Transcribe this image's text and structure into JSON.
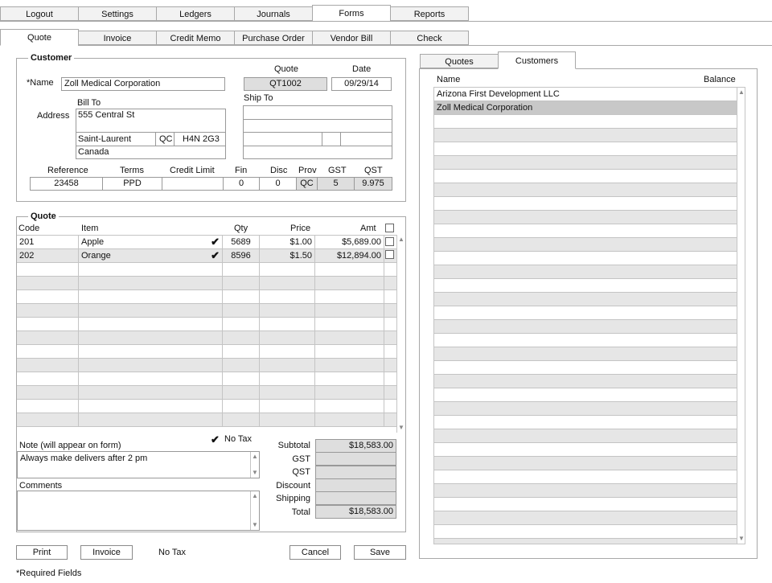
{
  "main_tabs": [
    "Logout",
    "Settings",
    "Ledgers",
    "Journals",
    "Forms",
    "Reports"
  ],
  "form_tabs": [
    "Quote",
    "Invoice",
    "Credit Memo",
    "Purchase Order",
    "Vendor Bill",
    "Check"
  ],
  "customer": {
    "legend": "Customer",
    "name_label": "*Name",
    "name": "Zoll Medical Corporation",
    "quote_label": "Quote",
    "quote_no": "QT1002",
    "date_label": "Date",
    "date": "09/29/14",
    "bill_to_label": "Bill To",
    "ship_to_label": "Ship To",
    "address_label": "Address",
    "address1": "555 Central St",
    "city": "Saint-Laurent",
    "prov": "QC",
    "postal": "H4N 2G3",
    "country": "Canada",
    "reference_label": "Reference",
    "terms_label": "Terms",
    "credit_limit_label": "Credit Limit",
    "fin_label": "Fin",
    "disc_label": "Disc",
    "prov_label": "Prov",
    "gst_label": "GST",
    "qst_label": "QST",
    "reference": "23458",
    "terms": "PPD",
    "credit_limit": "",
    "fin": "0",
    "disc": "0",
    "prov_value": "QC",
    "gst": "5",
    "qst": "9.975"
  },
  "quote": {
    "legend": "Quote",
    "headers": {
      "code": "Code",
      "item": "Item",
      "qty": "Qty",
      "price": "Price",
      "amt": "Amt"
    },
    "lines": [
      {
        "code": "201",
        "item": "Apple",
        "qty": "5689",
        "price": "$1.00",
        "amt": "$5,689.00"
      },
      {
        "code": "202",
        "item": "Orange",
        "qty": "8596",
        "price": "$1.50",
        "amt": "$12,894.00"
      }
    ],
    "check_glyph": "✔",
    "no_tax_label": "No Tax",
    "note_label": "Note (will appear on form)",
    "note": "Always make delivers after 2 pm",
    "comments_label": "Comments",
    "comments": "",
    "totals": {
      "subtotal_label": "Subtotal",
      "subtotal": "$18,583.00",
      "gst_label": "GST",
      "gst": "",
      "qst_label": "QST",
      "qst": "",
      "discount_label": "Discount",
      "discount": "",
      "shipping_label": "Shipping",
      "shipping": "",
      "total_label": "Total",
      "total": "$18,583.00"
    }
  },
  "buttons": {
    "print": "Print",
    "invoice": "Invoice",
    "no_tax": "No Tax",
    "cancel": "Cancel",
    "save": "Save"
  },
  "required_note": "*Required Fields",
  "side": {
    "tabs": [
      "Quotes",
      "Customers"
    ],
    "name_header": "Name",
    "balance_header": "Balance",
    "rows": [
      "Arizona First Development LLC",
      "Zoll Medical Corporation"
    ]
  }
}
